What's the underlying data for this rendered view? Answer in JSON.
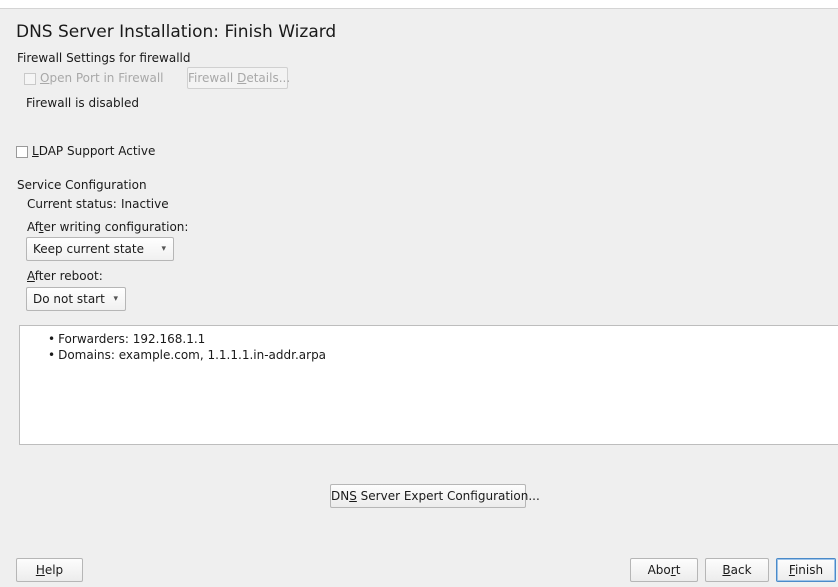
{
  "window": {
    "title": "DNS Server Installation: Finish Wizard"
  },
  "firewall": {
    "section_label": "Firewall Settings for firewalld",
    "open_port_label": "Open Port in Firewall",
    "details_button": "Firewall Details...",
    "status_text": "Firewall is disabled"
  },
  "ldap": {
    "label": "LDAP Support Active",
    "checked": false
  },
  "service": {
    "section_label": "Service Configuration",
    "current_status_label": "Current status:",
    "current_status_value": "Inactive",
    "after_writing_label": "After writing configuration:",
    "after_writing_value": "Keep current state",
    "after_reboot_label": "After reboot:",
    "after_reboot_value": "Do not start"
  },
  "summary": {
    "items": [
      "Forwarders: 192.168.1.1",
      "Domains: example.com, 1.1.1.1.in-addr.arpa"
    ]
  },
  "expert_button": "DNS Server Expert Configuration...",
  "footer": {
    "help": "Help",
    "abort": "Abort",
    "back": "Back",
    "finish": "Finish"
  },
  "colors": {
    "background": "#efefef",
    "default_button_border": "#4a8ac9"
  }
}
